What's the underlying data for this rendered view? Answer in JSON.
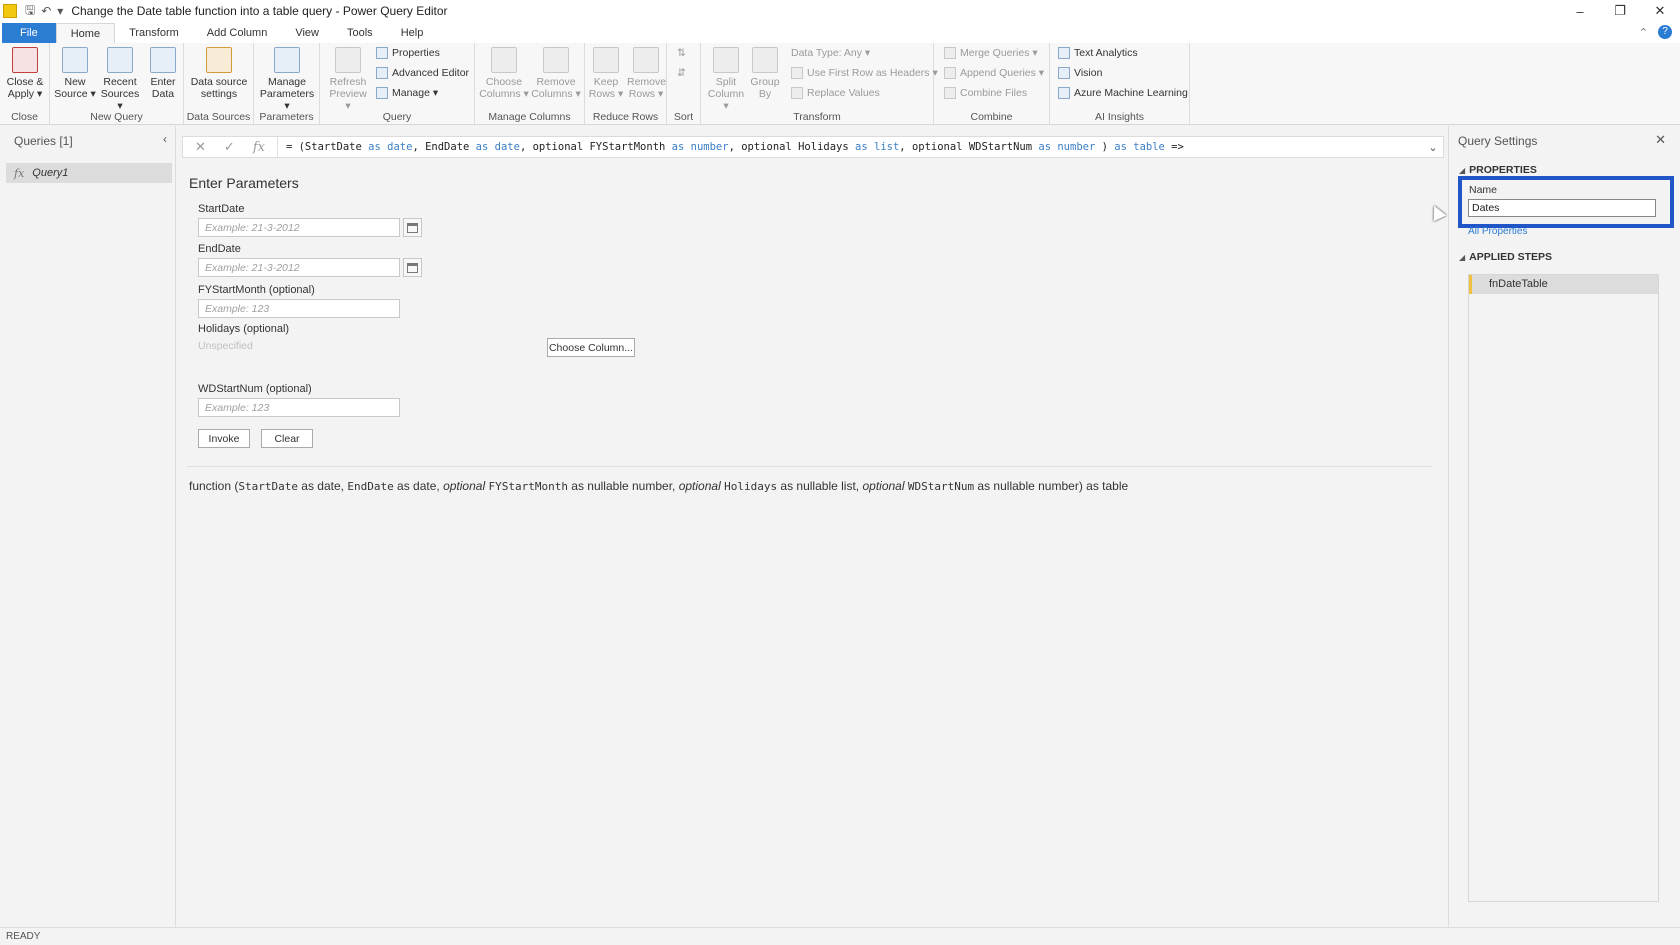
{
  "window": {
    "title": "Change the Date table function into a table query - Power Query Editor",
    "controls": [
      "–",
      "❐",
      "✕"
    ]
  },
  "tabs": [
    {
      "label": "File"
    },
    {
      "label": "Home"
    },
    {
      "label": "Transform"
    },
    {
      "label": "Add Column"
    },
    {
      "label": "View"
    },
    {
      "label": "Tools"
    },
    {
      "label": "Help"
    }
  ],
  "ribbon": {
    "close": {
      "label": "Close",
      "close_apply": "Close & Apply ▾"
    },
    "new_query": {
      "label": "New Query",
      "new_source": "New Source ▾",
      "recent_sources": "Recent Sources ▾",
      "enter_data": "Enter Data"
    },
    "data_sources": {
      "label": "Data Sources",
      "settings": "Data source settings"
    },
    "parameters": {
      "label": "Parameters",
      "manage": "Manage Parameters ▾"
    },
    "query": {
      "label": "Query",
      "refresh": "Refresh Preview ▾",
      "properties": "Properties",
      "advanced_editor": "Advanced Editor",
      "manage": "Manage ▾"
    },
    "manage_columns": {
      "label": "Manage Columns",
      "choose": "Choose Columns ▾",
      "remove": "Remove Columns ▾"
    },
    "reduce_rows": {
      "label": "Reduce Rows",
      "keep": "Keep Rows ▾",
      "remove": "Remove Rows ▾"
    },
    "sort": {
      "label": "Sort"
    },
    "transform": {
      "label": "Transform",
      "split": "Split Column ▾",
      "group": "Group By",
      "data_type": "Data Type: Any ▾",
      "first_row": "Use First Row as Headers ▾",
      "replace": "Replace Values"
    },
    "combine": {
      "label": "Combine",
      "merge": "Merge Queries ▾",
      "append": "Append Queries ▾",
      "combine_files": "Combine Files"
    },
    "ai": {
      "label": "AI Insights",
      "text": "Text Analytics",
      "vision": "Vision",
      "azure": "Azure Machine Learning"
    }
  },
  "queries_pane": {
    "header": "Queries [1]",
    "items": [
      {
        "label": "Query1"
      }
    ]
  },
  "formula_bar": {
    "prefix": "= (StartDate ",
    "parts": [
      {
        "t": "= (StartDate ",
        "k": false
      },
      {
        "t": "as",
        "k": true
      },
      {
        "t": " ",
        "k": false
      },
      {
        "t": "date",
        "k": true
      },
      {
        "t": ", EndDate ",
        "k": false
      },
      {
        "t": "as",
        "k": true
      },
      {
        "t": " ",
        "k": false
      },
      {
        "t": "date",
        "k": true
      },
      {
        "t": ", optional FYStartMonth ",
        "k": false
      },
      {
        "t": "as",
        "k": true
      },
      {
        "t": " ",
        "k": false
      },
      {
        "t": "number",
        "k": true
      },
      {
        "t": ", optional Holidays ",
        "k": false
      },
      {
        "t": "as",
        "k": true
      },
      {
        "t": " ",
        "k": false
      },
      {
        "t": "list",
        "k": true
      },
      {
        "t": ", optional WDStartNum ",
        "k": false
      },
      {
        "t": "as",
        "k": true
      },
      {
        "t": " ",
        "k": false
      },
      {
        "t": "number",
        "k": true
      },
      {
        "t": " ) ",
        "k": false
      },
      {
        "t": "as",
        "k": true
      },
      {
        "t": " ",
        "k": false
      },
      {
        "t": "table",
        "k": true
      },
      {
        "t": " =>",
        "k": false
      }
    ]
  },
  "params": {
    "title": "Enter Parameters",
    "start_label": "StartDate",
    "start_placeholder": "Example: 21-3-2012",
    "end_label": "EndDate",
    "end_placeholder": "Example: 21-3-2012",
    "fy_label": "FYStartMonth (optional)",
    "fy_placeholder": "Example: 123",
    "holidays_label": "Holidays (optional)",
    "holidays_value": "Unspecified",
    "choose_column": "Choose Column...",
    "wd_label": "WDStartNum (optional)",
    "wd_placeholder": "Example: 123",
    "invoke": "Invoke",
    "clear": "Clear"
  },
  "signature": {
    "s1": "function (",
    "p1": "StartDate",
    "s2": " as date, ",
    "p2": "EndDate",
    "s3": " as date, ",
    "o3": "optional",
    "p3": "FYStartMonth",
    "s4": " as nullable number, ",
    "o4": "optional",
    "p4": "Holidays",
    "s5": " as nullable list, ",
    "o5": "optional",
    "p5": "WDStartNum",
    "s6": " as nullable number) as table"
  },
  "query_settings": {
    "title": "Query Settings",
    "properties": "PROPERTIES",
    "name_label": "Name",
    "name_value": "Dates",
    "all_properties": "All Properties",
    "applied_steps": "APPLIED STEPS",
    "steps": [
      {
        "label": "fnDateTable"
      }
    ]
  },
  "status": {
    "text": "READY"
  },
  "colors": {
    "accent": "#2b7cd3",
    "highlight_border": "#1f55c6"
  }
}
